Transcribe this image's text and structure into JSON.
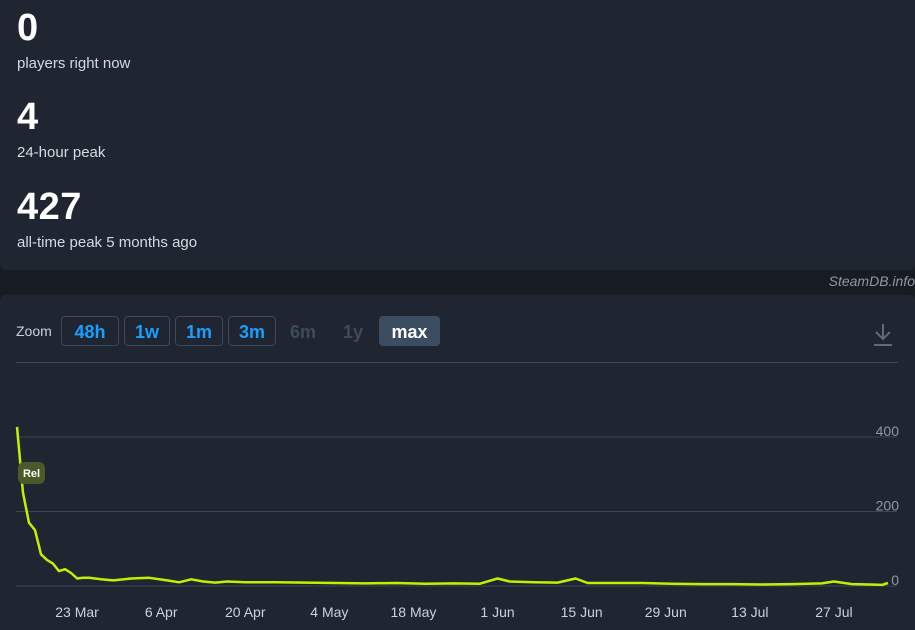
{
  "stats": [
    {
      "value": "0",
      "label": "players right now"
    },
    {
      "value": "4",
      "label": "24-hour peak"
    },
    {
      "value": "427",
      "label": "all-time peak 5 months ago"
    }
  ],
  "credit": "SteamDB.info",
  "zoom": {
    "label": "Zoom",
    "buttons": [
      {
        "label": "48h",
        "state": "active"
      },
      {
        "label": "1w",
        "state": "active"
      },
      {
        "label": "1m",
        "state": "active"
      },
      {
        "label": "3m",
        "state": "active"
      },
      {
        "label": "6m",
        "state": "disabled"
      },
      {
        "label": "1y",
        "state": "disabled"
      },
      {
        "label": "max",
        "state": "selected"
      }
    ]
  },
  "colors": {
    "line": "#c4f000",
    "marker_bg": "#4a5a2a",
    "grid": "#3a4452"
  },
  "icons": {
    "download": "download-icon"
  },
  "chart_data": {
    "type": "line",
    "title": "",
    "xlabel": "",
    "ylabel": "",
    "ylim": [
      0,
      420
    ],
    "yticks": [
      0,
      200,
      400
    ],
    "x_ticks": [
      "23 Mar",
      "6 Apr",
      "20 Apr",
      "4 May",
      "18 May",
      "1 Jun",
      "15 Jun",
      "29 Jun",
      "13 Jul",
      "27 Jul"
    ],
    "grid": true,
    "legend": "none",
    "annotation": {
      "label": "Rel",
      "x": "2025-03-13"
    },
    "series": [
      {
        "x": [
          "2025-03-13",
          "2025-03-14",
          "2025-03-15",
          "2025-03-16",
          "2025-03-17",
          "2025-03-18",
          "2025-03-19",
          "2025-03-20",
          "2025-03-21",
          "2025-03-22",
          "2025-03-23",
          "2025-03-24",
          "2025-03-25",
          "2025-03-27",
          "2025-03-29",
          "2025-04-01",
          "2025-04-04",
          "2025-04-07",
          "2025-04-09",
          "2025-04-11",
          "2025-04-13",
          "2025-04-15",
          "2025-04-17",
          "2025-04-20",
          "2025-04-25",
          "2025-04-30",
          "2025-05-05",
          "2025-05-10",
          "2025-05-15",
          "2025-05-20",
          "2025-05-25",
          "2025-05-29",
          "2025-06-01",
          "2025-06-03",
          "2025-06-07",
          "2025-06-11",
          "2025-06-14",
          "2025-06-16",
          "2025-06-20",
          "2025-06-25",
          "2025-06-30",
          "2025-07-05",
          "2025-07-10",
          "2025-07-15",
          "2025-07-20",
          "2025-07-25",
          "2025-07-27",
          "2025-07-30",
          "2025-08-02",
          "2025-08-04",
          "2025-08-05"
        ],
        "values": [
          427,
          250,
          170,
          150,
          85,
          70,
          60,
          40,
          45,
          35,
          20,
          22,
          22,
          18,
          15,
          20,
          22,
          15,
          10,
          18,
          12,
          9,
          12,
          10,
          10,
          9,
          8,
          7,
          8,
          6,
          7,
          6,
          20,
          12,
          10,
          9,
          20,
          8,
          8,
          8,
          6,
          5,
          5,
          4,
          5,
          7,
          12,
          5,
          4,
          3,
          8
        ]
      }
    ]
  }
}
